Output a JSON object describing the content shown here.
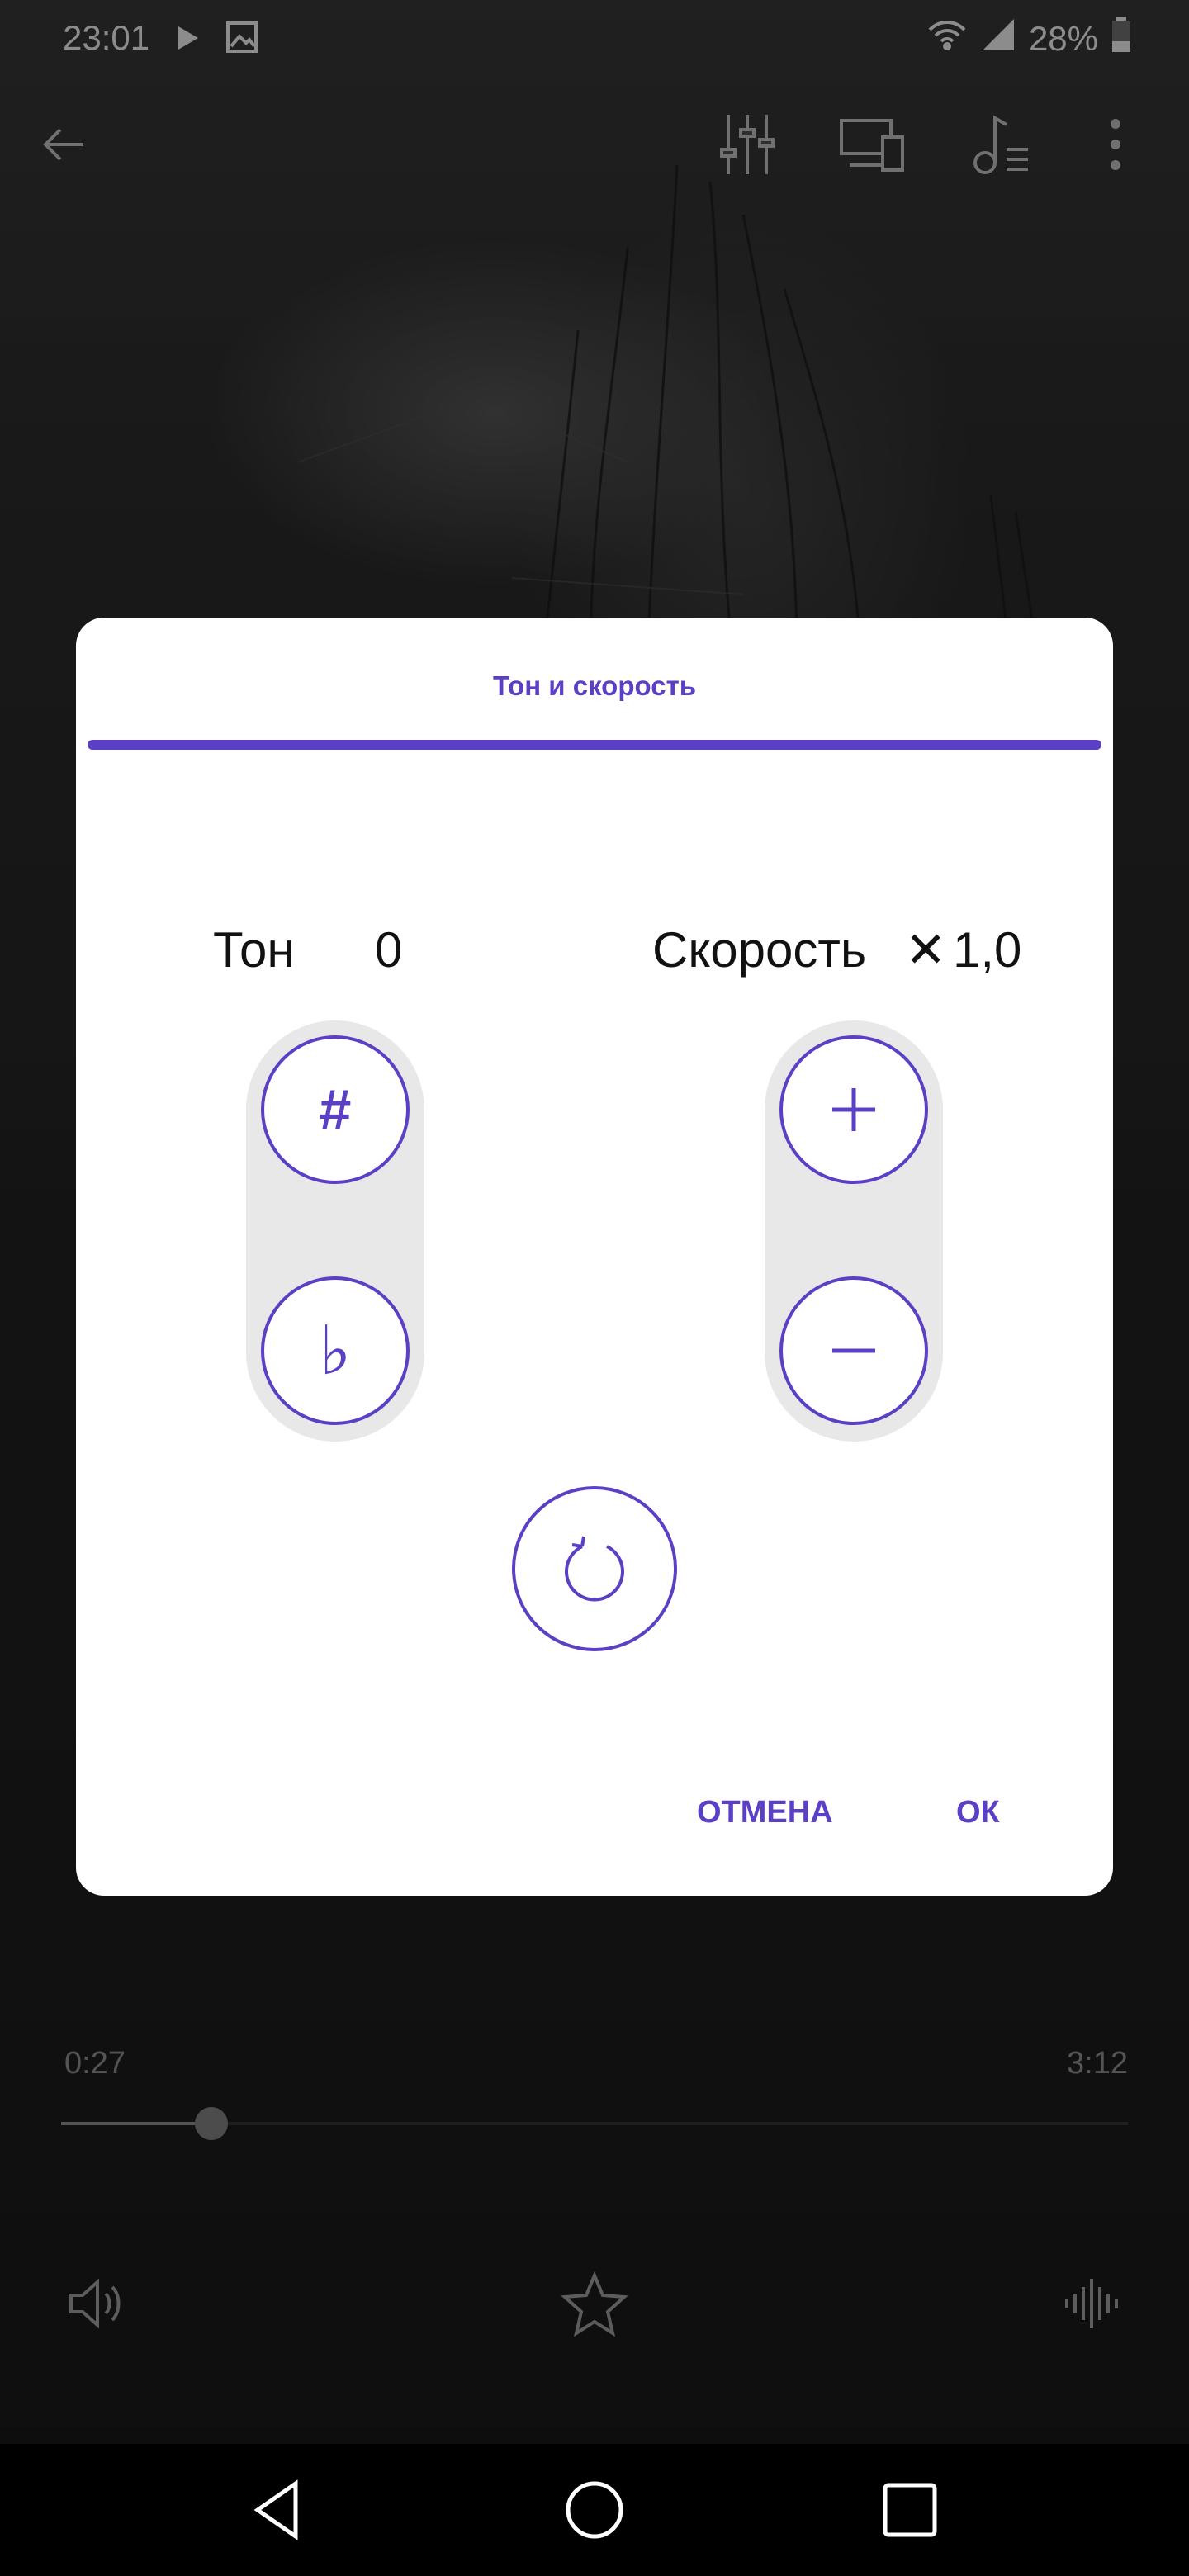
{
  "status_bar": {
    "time": "23:01",
    "battery": "28%",
    "icons": [
      "play-icon",
      "image-icon",
      "wifi-icon",
      "signal-icon",
      "battery-icon"
    ]
  },
  "toolbar": {
    "icons": [
      "back-arrow-icon",
      "equalizer-icon",
      "cast-devices-icon",
      "lyrics-icon",
      "more-vert-icon"
    ]
  },
  "player": {
    "elapsed": "0:27",
    "duration": "3:12",
    "progress": 0.14,
    "bottom_icons": [
      "volume-icon",
      "star-icon",
      "waveform-icon"
    ]
  },
  "dialog": {
    "title": "Тон и скорость",
    "pitch": {
      "label": "Тон",
      "value": "0",
      "up_glyph": "#",
      "down_glyph": "♭"
    },
    "speed": {
      "label": "Скорость",
      "prefix": "✕",
      "value": "1,0",
      "up_glyph": "+",
      "down_glyph": "−"
    },
    "cancel_label": "ОТМЕНА",
    "ok_label": "ОК"
  },
  "colors": {
    "accent": "#5b3fc4",
    "pill_bg": "#e8e8e8",
    "dialog_bg": "#ffffff",
    "scrim": "rgba(0,0,0,0.45)"
  },
  "nav_bar": {
    "icons": [
      "nav-back-icon",
      "nav-home-icon",
      "nav-recents-icon"
    ]
  }
}
